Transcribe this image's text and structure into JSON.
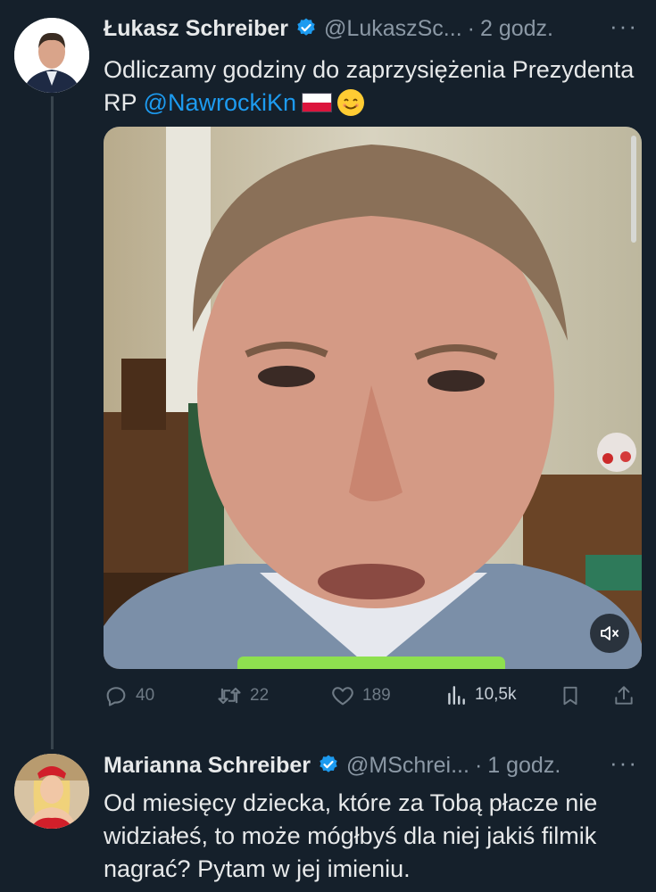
{
  "tweet1": {
    "author_name": "Łukasz Schreiber",
    "author_handle": "@LukaszSc...",
    "time": "2 godz.",
    "text_before_mention": "Odliczamy godziny do zaprzysiężenia Prezydenta RP ",
    "mention": "@NawrockiKn",
    "stats": {
      "replies": "40",
      "retweets": "22",
      "likes": "189",
      "views": "10,5k"
    }
  },
  "tweet2": {
    "author_name": "Marianna Schreiber",
    "author_handle": "@MSchrei...",
    "time": "1 godz.",
    "text": "Od miesięcy dziecka, które za Tobą płacze nie widziałeś, to może mógłbyś dla niej jakiś filmik nagrać? Pytam w jej imieniu."
  },
  "more_label": "···",
  "separator": "·",
  "colors": {
    "background": "#15202b",
    "verified": "#1d9bf0",
    "mention": "#1d9bf0",
    "muted": "#8b98a5",
    "video_progress": "#8ee04f"
  },
  "icons": [
    "verified-badge-icon",
    "reply-icon",
    "retweet-icon",
    "like-icon",
    "views-icon",
    "bookmark-icon",
    "share-icon",
    "mute-icon",
    "more-icon"
  ]
}
